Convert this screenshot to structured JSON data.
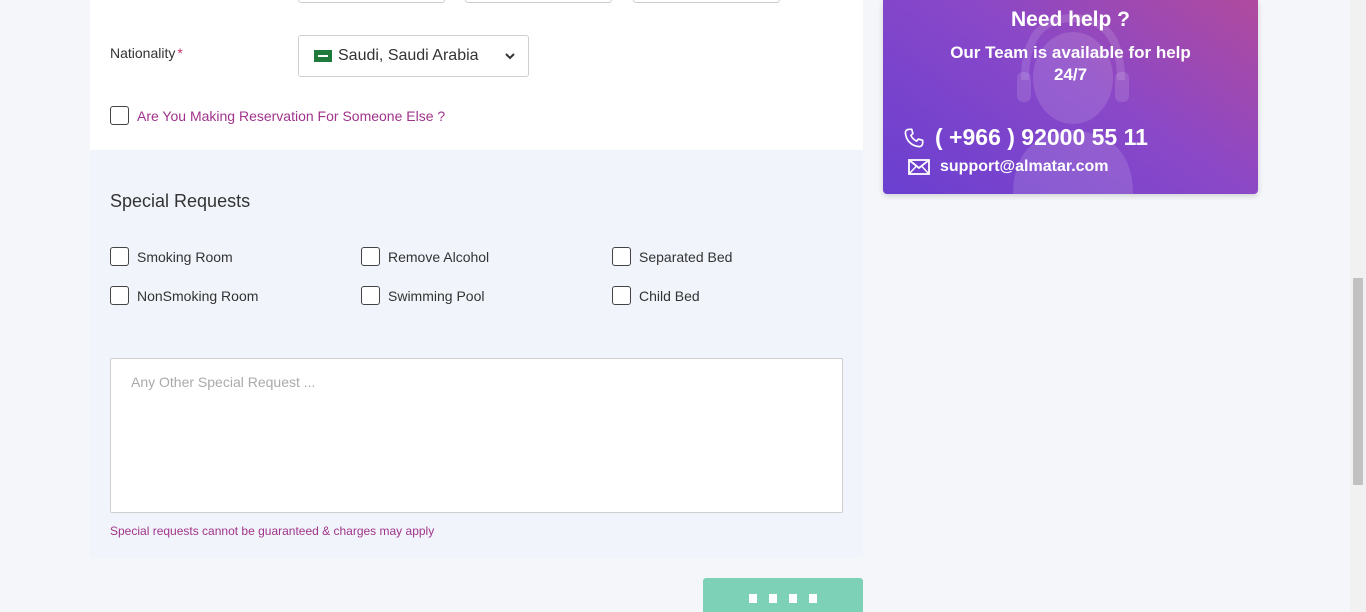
{
  "form": {
    "nationality_label": "Nationality",
    "required_mark": "*",
    "nationality_value": "Saudi, Saudi Arabia",
    "reservation_else_label": "Are You Making Reservation For Someone Else ?"
  },
  "special": {
    "title": "Special Requests",
    "options": [
      "Smoking Room",
      "Remove Alcohol",
      "Separated Bed",
      "NonSmoking Room",
      "Swimming Pool",
      "Child Bed"
    ],
    "textarea_placeholder": "Any Other Special Request ...",
    "note": "Special requests cannot be guaranteed & charges may apply"
  },
  "help": {
    "title": "Need help ?",
    "subtitle": "Our Team is available for help 24/7",
    "phone": "( +966 ) 92000 55 11",
    "email": "support@almatar.com"
  },
  "colors": {
    "accent": "#a0338b",
    "required": "#c0306c",
    "submit": "#7dd1b7",
    "help_gradient_start": "#6a3fd0",
    "help_gradient_end": "#b04a9e"
  }
}
